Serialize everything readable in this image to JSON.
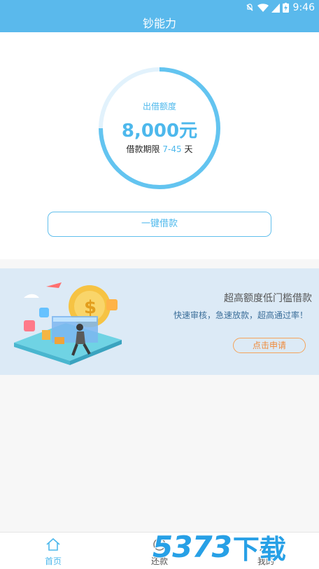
{
  "status_bar": {
    "time": "9:46",
    "icons": [
      "mute-icon",
      "wifi-icon",
      "signal-icon",
      "battery-charging-icon"
    ]
  },
  "app_bar": {
    "title": "钞能力"
  },
  "quota": {
    "label": "出借额度",
    "amount": "8,000元",
    "term_label": "借款期限",
    "term_range": "7-45",
    "term_unit": "天"
  },
  "cta": {
    "label": "一键借款"
  },
  "banner": {
    "title": "超高额度低门槛借款",
    "subtitle": "快速审核，急速放款，超高通过率！",
    "button_label": "点击申请",
    "button_color": "#f4a35a"
  },
  "nav": {
    "items": [
      {
        "label": "首页",
        "icon": "home-icon",
        "active": true
      },
      {
        "label": "还款",
        "icon": "repay-icon",
        "active": false
      },
      {
        "label": "我的",
        "icon": "profile-icon",
        "active": false
      }
    ]
  },
  "watermark": {
    "number": "5373",
    "text": "下载"
  },
  "colors": {
    "accent": "#4db8ec",
    "status_bar": "#5ab9ec",
    "banner_bg": "#dceaf6"
  }
}
